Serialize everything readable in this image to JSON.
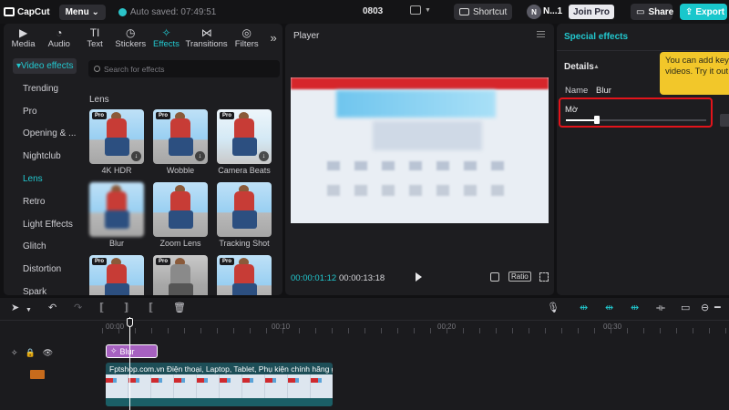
{
  "app": {
    "logo_text": "CapCut",
    "menu_label": "Menu",
    "saved_text": "Auto saved: 07:49:51",
    "project_name": "0803"
  },
  "topbar": {
    "shortcut_label": "Shortcut",
    "avatar_initial": "N",
    "user_name": "N...1",
    "join_pro_label": "Join Pro",
    "share_label": "Share",
    "export_label": "Export"
  },
  "tabs": [
    {
      "label": "Media",
      "icon": "media-icon"
    },
    {
      "label": "Audio",
      "icon": "audio-icon"
    },
    {
      "label": "Text",
      "icon": "text-icon"
    },
    {
      "label": "Stickers",
      "icon": "stickers-icon"
    },
    {
      "label": "Effects",
      "icon": "effects-icon"
    },
    {
      "label": "Transitions",
      "icon": "transitions-icon"
    },
    {
      "label": "Filters",
      "icon": "filters-icon"
    }
  ],
  "sidebar": {
    "header": "Video effects",
    "items": [
      "Trending",
      "Pro",
      "Opening & ...",
      "Nightclub",
      "Lens",
      "Retro",
      "Light Effects",
      "Glitch",
      "Distortion",
      "Spark"
    ]
  },
  "search": {
    "placeholder": "Search for effects"
  },
  "section_title": "Lens",
  "effects": [
    {
      "label": "4K HDR",
      "pro": "Pro"
    },
    {
      "label": "Wobble",
      "pro": "Pro"
    },
    {
      "label": "Camera Beats",
      "pro": "Pro"
    },
    {
      "label": "Blur",
      "pro": ""
    },
    {
      "label": "Zoom Lens",
      "pro": ""
    },
    {
      "label": "Tracking Shot",
      "pro": ""
    },
    {
      "label": "",
      "pro": "Pro"
    },
    {
      "label": "",
      "pro": "Pro"
    },
    {
      "label": "",
      "pro": "Pro"
    }
  ],
  "player": {
    "title": "Player",
    "current_time": "00:00:01:12",
    "total_time": "00:00:13:18",
    "ratio_label": "Ratio"
  },
  "inspector": {
    "title": "Special effects",
    "details_label": "Details",
    "name_label": "Name",
    "name_value": "Blur",
    "param_label": "Mờ",
    "param_value": 0.22,
    "tooltip_line1": "You can add keyfra",
    "tooltip_line2": "videos. Try it out!"
  },
  "timeline": {
    "ticks": [
      "00:00",
      "00:10",
      "00:20",
      "00:30"
    ],
    "effect_clip_label": "Blur",
    "video_clip_label": "Fptshop.com.vn    Điện thoại, Laptop, Tablet, Phụ kiện chính hãng giá"
  },
  "colors": {
    "accent": "#22c8cf",
    "highlight": "#e3141b",
    "tooltip": "#f2c72a",
    "effect_clip": "#a661c0"
  }
}
